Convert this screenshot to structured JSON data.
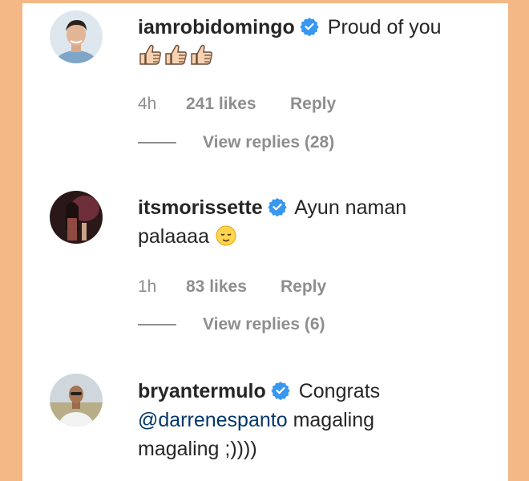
{
  "comments": [
    {
      "username": "iamrobidomingo",
      "text": "Proud of you",
      "emojis": [
        "thumbs-up",
        "thumbs-up",
        "thumbs-up"
      ],
      "time": "4h",
      "likes": "241 likes",
      "reply": "Reply",
      "view_replies": "View replies (28)"
    },
    {
      "username": "itsmorissette",
      "text": "Ayun naman",
      "text2": "palaaaa",
      "emoji": "relieved-face",
      "time": "1h",
      "likes": "83 likes",
      "reply": "Reply",
      "view_replies": "View replies (6)"
    },
    {
      "username": "bryantermulo",
      "text": "Congrats",
      "mention": "@darrenespanto",
      "text2": "magaling",
      "text3": "magaling ;))))"
    }
  ],
  "colors": {
    "background": "#F4B886",
    "verified": "#3897F0",
    "mention": "#00376B",
    "meta": "#8E8E8E"
  }
}
